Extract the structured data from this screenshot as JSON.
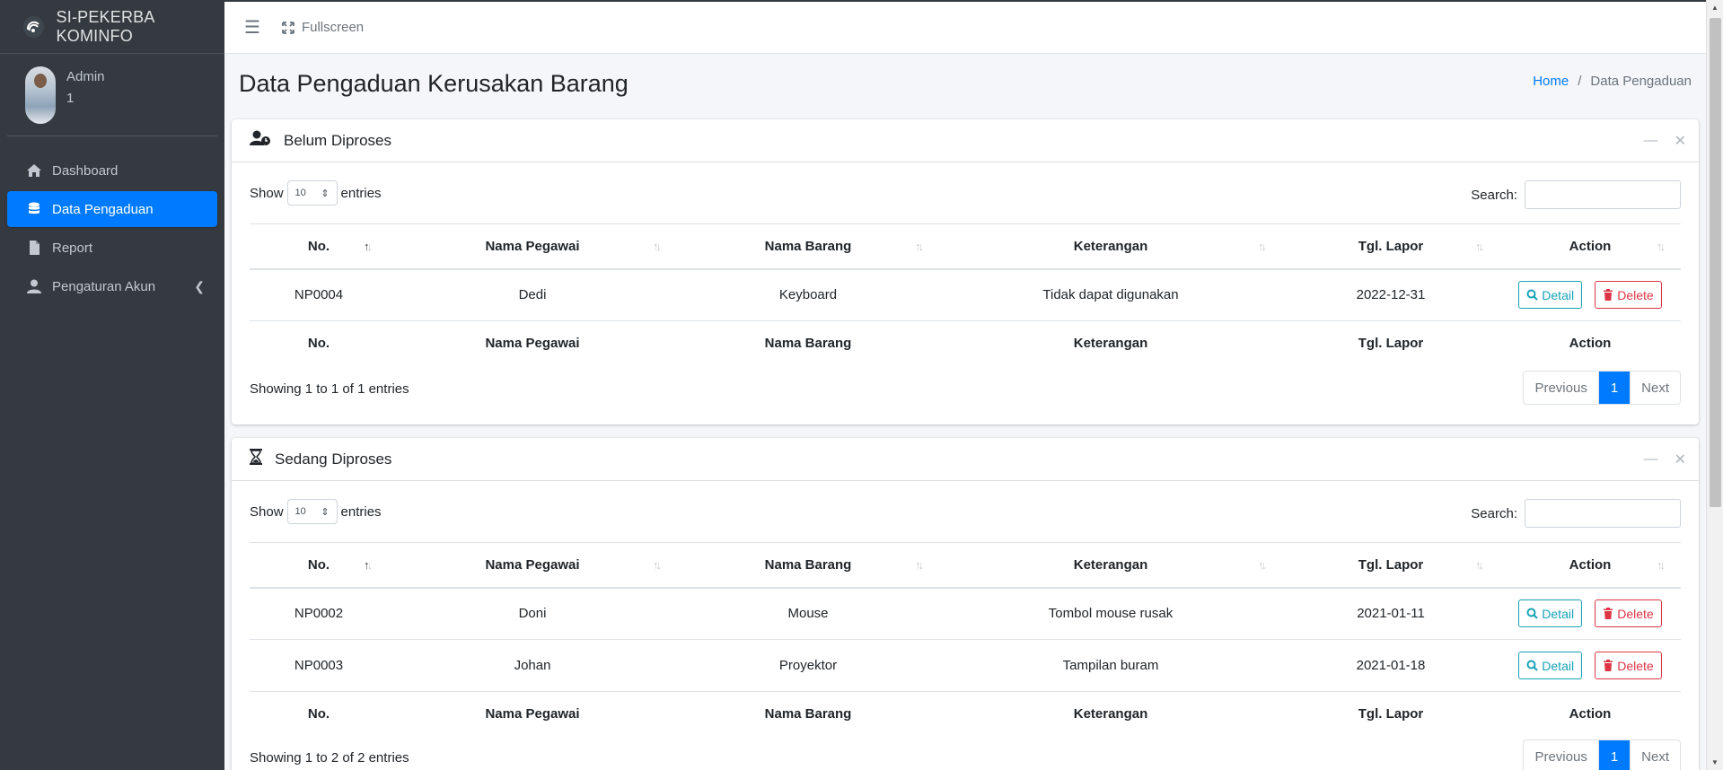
{
  "brand": {
    "title": "SI-PEKERBA KOMINFO",
    "logo_icon": "kominfo-logo-icon"
  },
  "user": {
    "name": "Admin",
    "id": "1"
  },
  "sidebar": {
    "items": [
      {
        "label": "Dashboard",
        "icon": "home-icon",
        "active": false
      },
      {
        "label": "Data Pengaduan",
        "icon": "database-icon",
        "active": true
      },
      {
        "label": "Report",
        "icon": "file-icon",
        "active": false
      },
      {
        "label": "Pengaturan Akun",
        "icon": "user-icon",
        "active": false
      }
    ]
  },
  "header": {
    "fullscreen_label": "Fullscreen"
  },
  "page": {
    "title": "Data Pengaduan Kerusakan Barang"
  },
  "breadcrumb": {
    "home": "Home",
    "separator": "/",
    "current": "Data Pengaduan"
  },
  "columns": [
    "No.",
    "Nama Pegawai",
    "Nama Barang",
    "Keterangan",
    "Tgl. Lapor",
    "Action"
  ],
  "controls": {
    "show": "Show",
    "entries": "entries",
    "length_value": "10",
    "search_label": "Search:"
  },
  "buttons": {
    "detail": "Detail",
    "delete": "Delete"
  },
  "pager": {
    "previous": "Previous",
    "page": "1",
    "next": "Next"
  },
  "cards": [
    {
      "title": "Belum Diproses",
      "icon": "user-clock-icon",
      "rows": [
        {
          "no": "NP0004",
          "pegawai": "Dedi",
          "barang": "Keyboard",
          "keterangan": "Tidak dapat digunakan",
          "tgl": "2022-12-31"
        }
      ],
      "info": "Showing 1 to 1 of 1 entries"
    },
    {
      "title": "Sedang Diproses",
      "icon": "hourglass-icon",
      "rows": [
        {
          "no": "NP0002",
          "pegawai": "Doni",
          "barang": "Mouse",
          "keterangan": "Tombol mouse rusak",
          "tgl": "2021-01-11"
        },
        {
          "no": "NP0003",
          "pegawai": "Johan",
          "barang": "Proyektor",
          "keterangan": "Tampilan buram",
          "tgl": "2021-01-18"
        }
      ],
      "info": "Showing 1 to 2 of 2 entries"
    }
  ],
  "colors": {
    "primary": "#007bff",
    "sidebar": "#343a40",
    "info": "#17a2b8",
    "danger": "#dc3545"
  }
}
